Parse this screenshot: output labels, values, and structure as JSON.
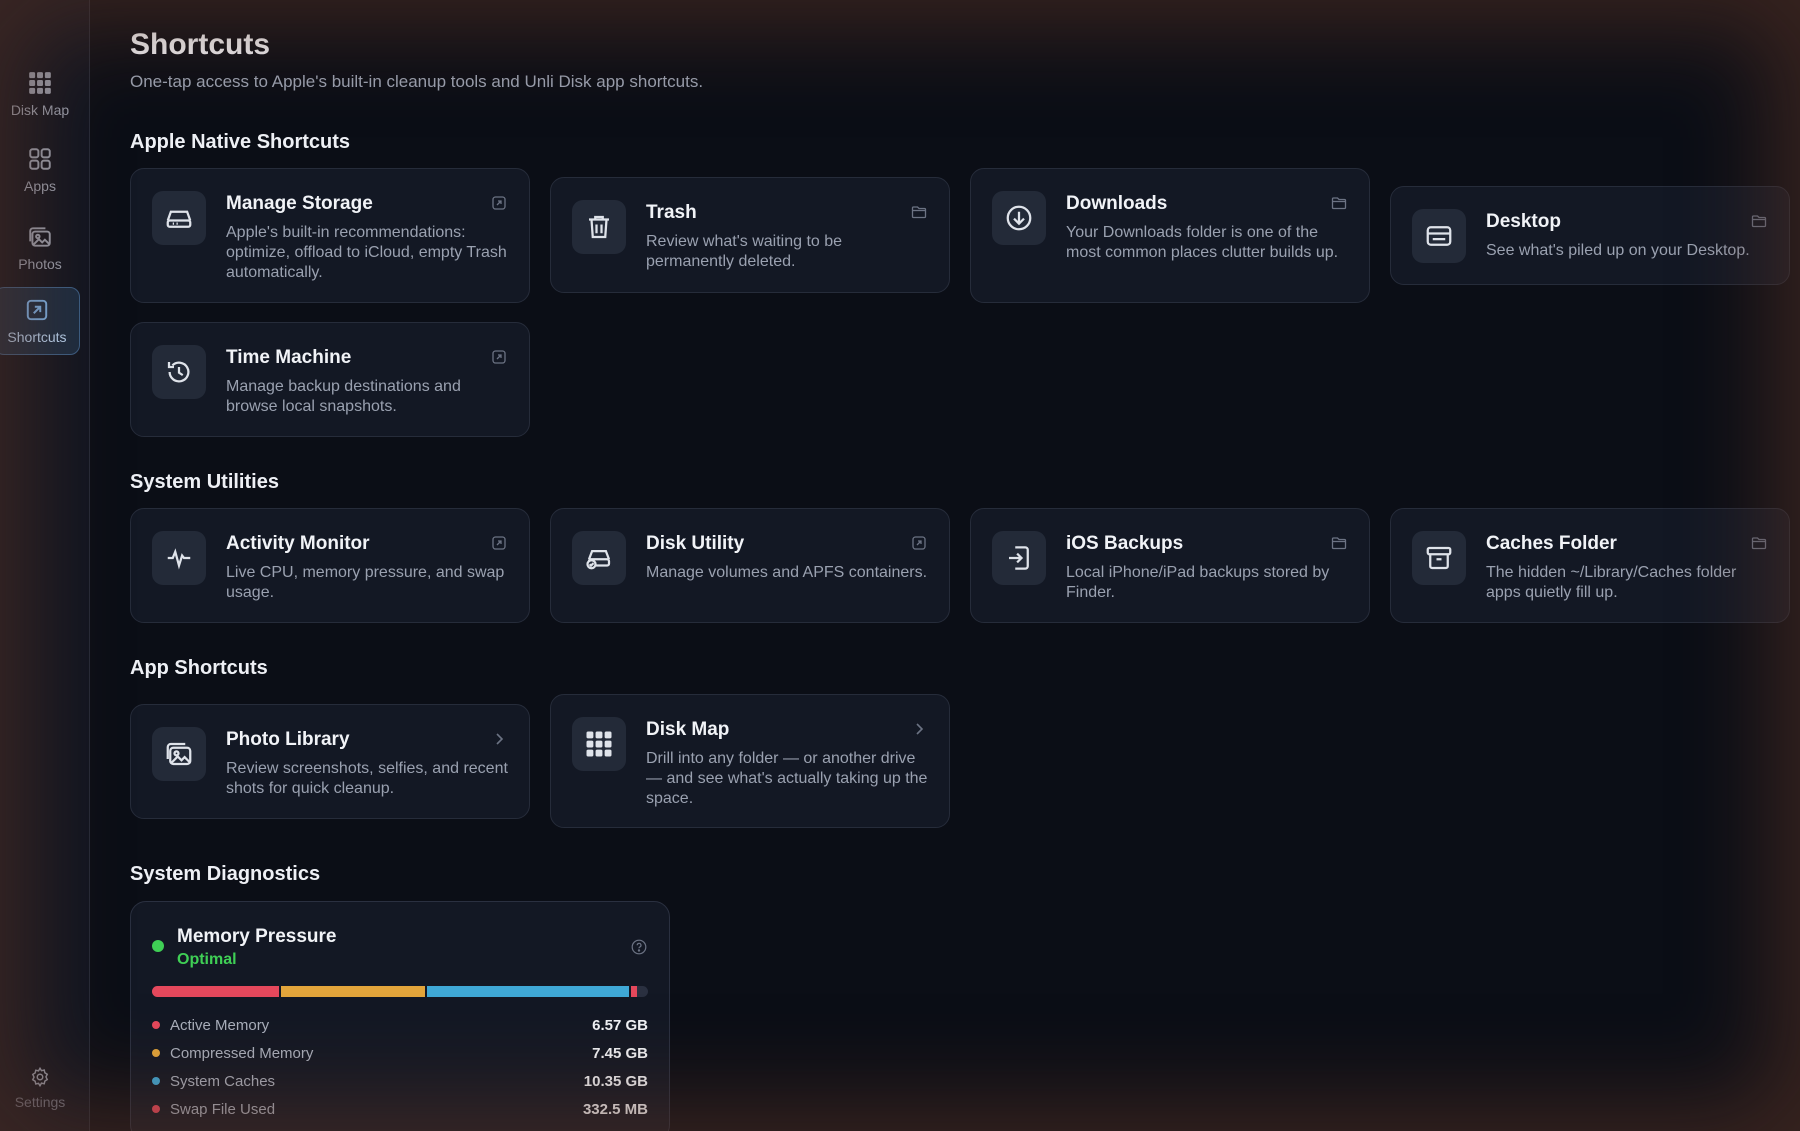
{
  "sidebar": {
    "items": [
      {
        "label": "Disk Map",
        "icon": "grid-dots-icon"
      },
      {
        "label": "Apps",
        "icon": "app-grid-icon"
      },
      {
        "label": "Photos",
        "icon": "photos-icon"
      },
      {
        "label": "Shortcuts",
        "icon": "shortcut-arrow-icon",
        "active": true
      }
    ],
    "settings_label": "Settings"
  },
  "header": {
    "title": "Shortcuts",
    "subtitle": "One-tap access to Apple's built-in cleanup tools and Unli Disk app shortcuts."
  },
  "sections": {
    "apple_native": {
      "title": "Apple Native Shortcuts",
      "cards": [
        {
          "title": "Manage Storage",
          "description": "Apple's built-in recommendations: optimize, offload to iCloud, empty Trash automatically.",
          "icon": "drive-icon",
          "action_icon": "external-link-icon"
        },
        {
          "title": "Trash",
          "description": "Review what's waiting to be permanently deleted.",
          "icon": "trash-icon",
          "action_icon": "folder-icon"
        },
        {
          "title": "Downloads",
          "description": "Your Downloads folder is one of the most common places clutter builds up.",
          "icon": "download-icon",
          "action_icon": "folder-icon"
        },
        {
          "title": "Desktop",
          "description": "See what's piled up on your Desktop.",
          "icon": "desktop-icon",
          "action_icon": "folder-icon"
        },
        {
          "title": "Time Machine",
          "description": "Manage backup destinations and browse local snapshots.",
          "icon": "time-machine-icon",
          "action_icon": "external-link-icon"
        }
      ]
    },
    "system_utilities": {
      "title": "System Utilities",
      "cards": [
        {
          "title": "Activity Monitor",
          "description": "Live CPU, memory pressure, and swap usage.",
          "icon": "pulse-icon",
          "action_icon": "external-link-icon"
        },
        {
          "title": "Disk Utility",
          "description": "Manage volumes and APFS containers.",
          "icon": "disk-check-icon",
          "action_icon": "external-link-icon"
        },
        {
          "title": "iOS Backups",
          "description": "Local iPhone/iPad backups stored by Finder.",
          "icon": "import-icon",
          "action_icon": "folder-icon"
        },
        {
          "title": "Caches Folder",
          "description": "The hidden ~/Library/Caches folder apps quietly fill up.",
          "icon": "archive-box-icon",
          "action_icon": "folder-icon"
        }
      ]
    },
    "app_shortcuts": {
      "title": "App Shortcuts",
      "cards": [
        {
          "title": "Photo Library",
          "description": "Review screenshots, selfies, and recent shots for quick cleanup.",
          "icon": "photos-icon",
          "action_icon": "chevron-right-icon"
        },
        {
          "title": "Disk Map",
          "description": "Drill into any folder — or another drive — and see what's actually taking up the space.",
          "icon": "grid-dots-icon",
          "action_icon": "chevron-right-icon"
        }
      ]
    },
    "diagnostics": {
      "title": "System Diagnostics",
      "memory": {
        "title": "Memory Pressure",
        "status": "Optimal",
        "status_color": "#3fcf55",
        "rows": [
          {
            "label": "Active Memory",
            "value": "6.57 GB",
            "color": "#e5485c",
            "share": 0.26
          },
          {
            "label": "Compressed Memory",
            "value": "7.45 GB",
            "color": "#e3a53b",
            "share": 0.295
          },
          {
            "label": "System Caches",
            "value": "10.35 GB",
            "color": "#3fa8d6",
            "share": 0.41
          },
          {
            "label": "Swap File Used",
            "value": "332.5 MB",
            "color": "#e5485c",
            "share": 0.013
          }
        ]
      }
    }
  }
}
